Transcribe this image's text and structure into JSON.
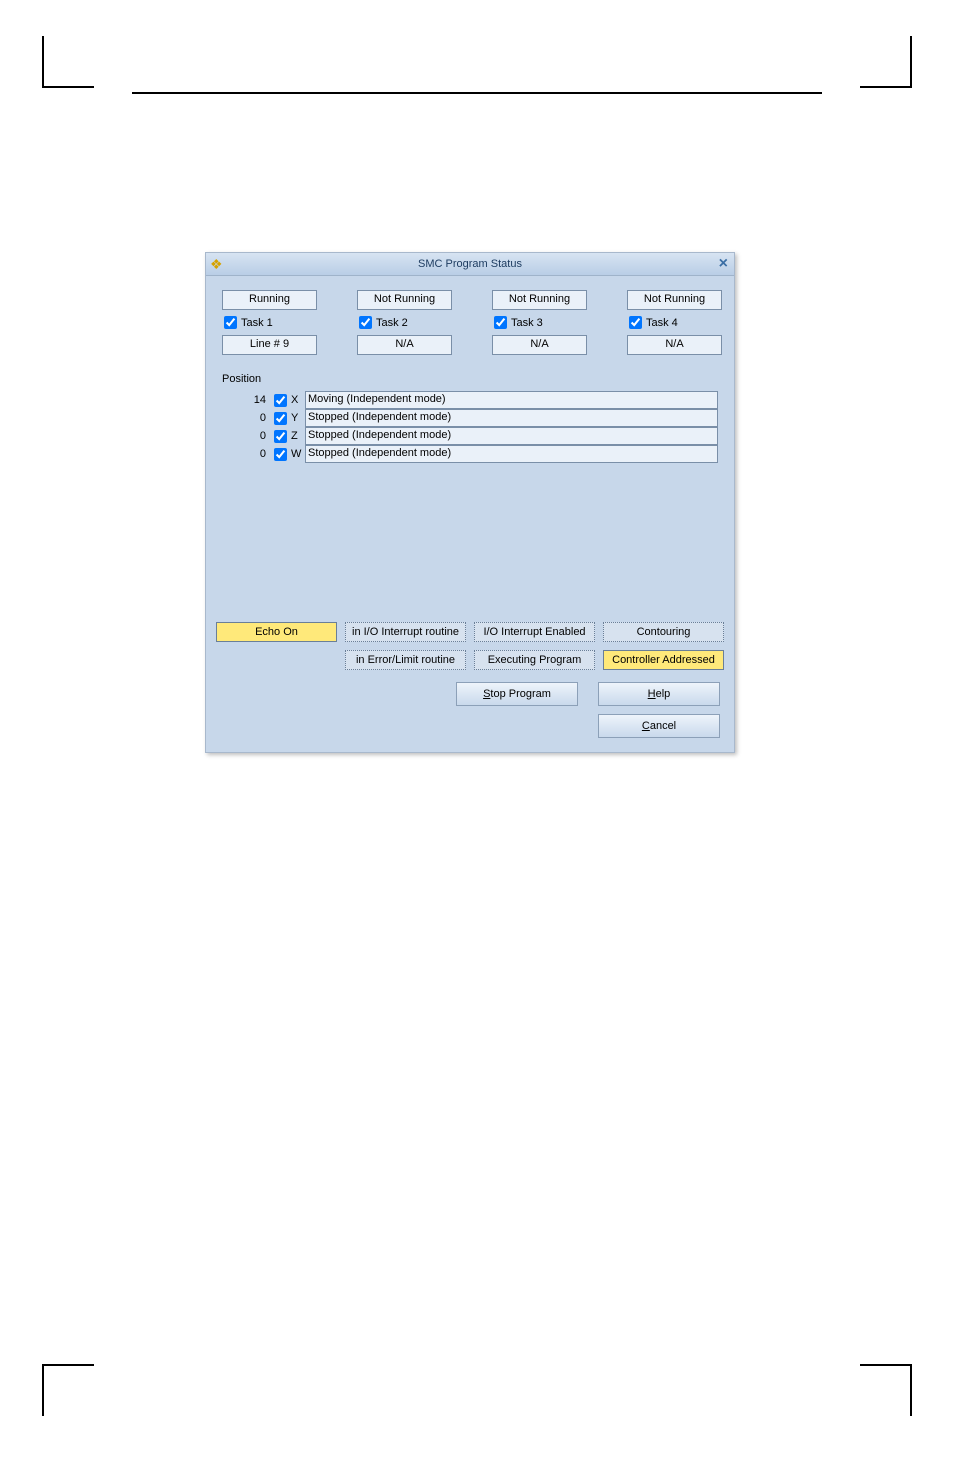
{
  "dialog": {
    "title": "SMC Program Status",
    "tasks": [
      {
        "status": "Running",
        "label": "Task 1",
        "checked": true,
        "line": "Line # 9"
      },
      {
        "status": "Not Running",
        "label": "Task 2",
        "checked": true,
        "line": "N/A"
      },
      {
        "status": "Not Running",
        "label": "Task 3",
        "checked": true,
        "line": "N/A"
      },
      {
        "status": "Not Running",
        "label": "Task 4",
        "checked": true,
        "line": "N/A"
      }
    ],
    "position_label": "Position",
    "axes": [
      {
        "value": "14",
        "checked": true,
        "letter": "X",
        "status": "Moving (Independent mode)"
      },
      {
        "value": "0",
        "checked": true,
        "letter": "Y",
        "status": "Stopped (Independent mode)"
      },
      {
        "value": "0",
        "checked": true,
        "letter": "Z",
        "status": "Stopped (Independent mode)"
      },
      {
        "value": "0",
        "checked": true,
        "letter": "W",
        "status": "Stopped (Independent mode)"
      }
    ],
    "status_buttons_row1": [
      {
        "label": "Echo On",
        "highlight": true
      },
      {
        "label": "in I/O Interrupt routine",
        "highlight": false
      },
      {
        "label": "I/O Interrupt Enabled",
        "highlight": false
      },
      {
        "label": "Contouring",
        "highlight": false
      }
    ],
    "status_buttons_row2": [
      {
        "label": "in Error/Limit routine",
        "highlight": false
      },
      {
        "label": "Executing Program",
        "highlight": false
      },
      {
        "label": "Controller Addressed",
        "highlight": true
      }
    ],
    "buttons": {
      "stop": "Stop Program",
      "help": "Help",
      "cancel": "Cancel"
    }
  }
}
